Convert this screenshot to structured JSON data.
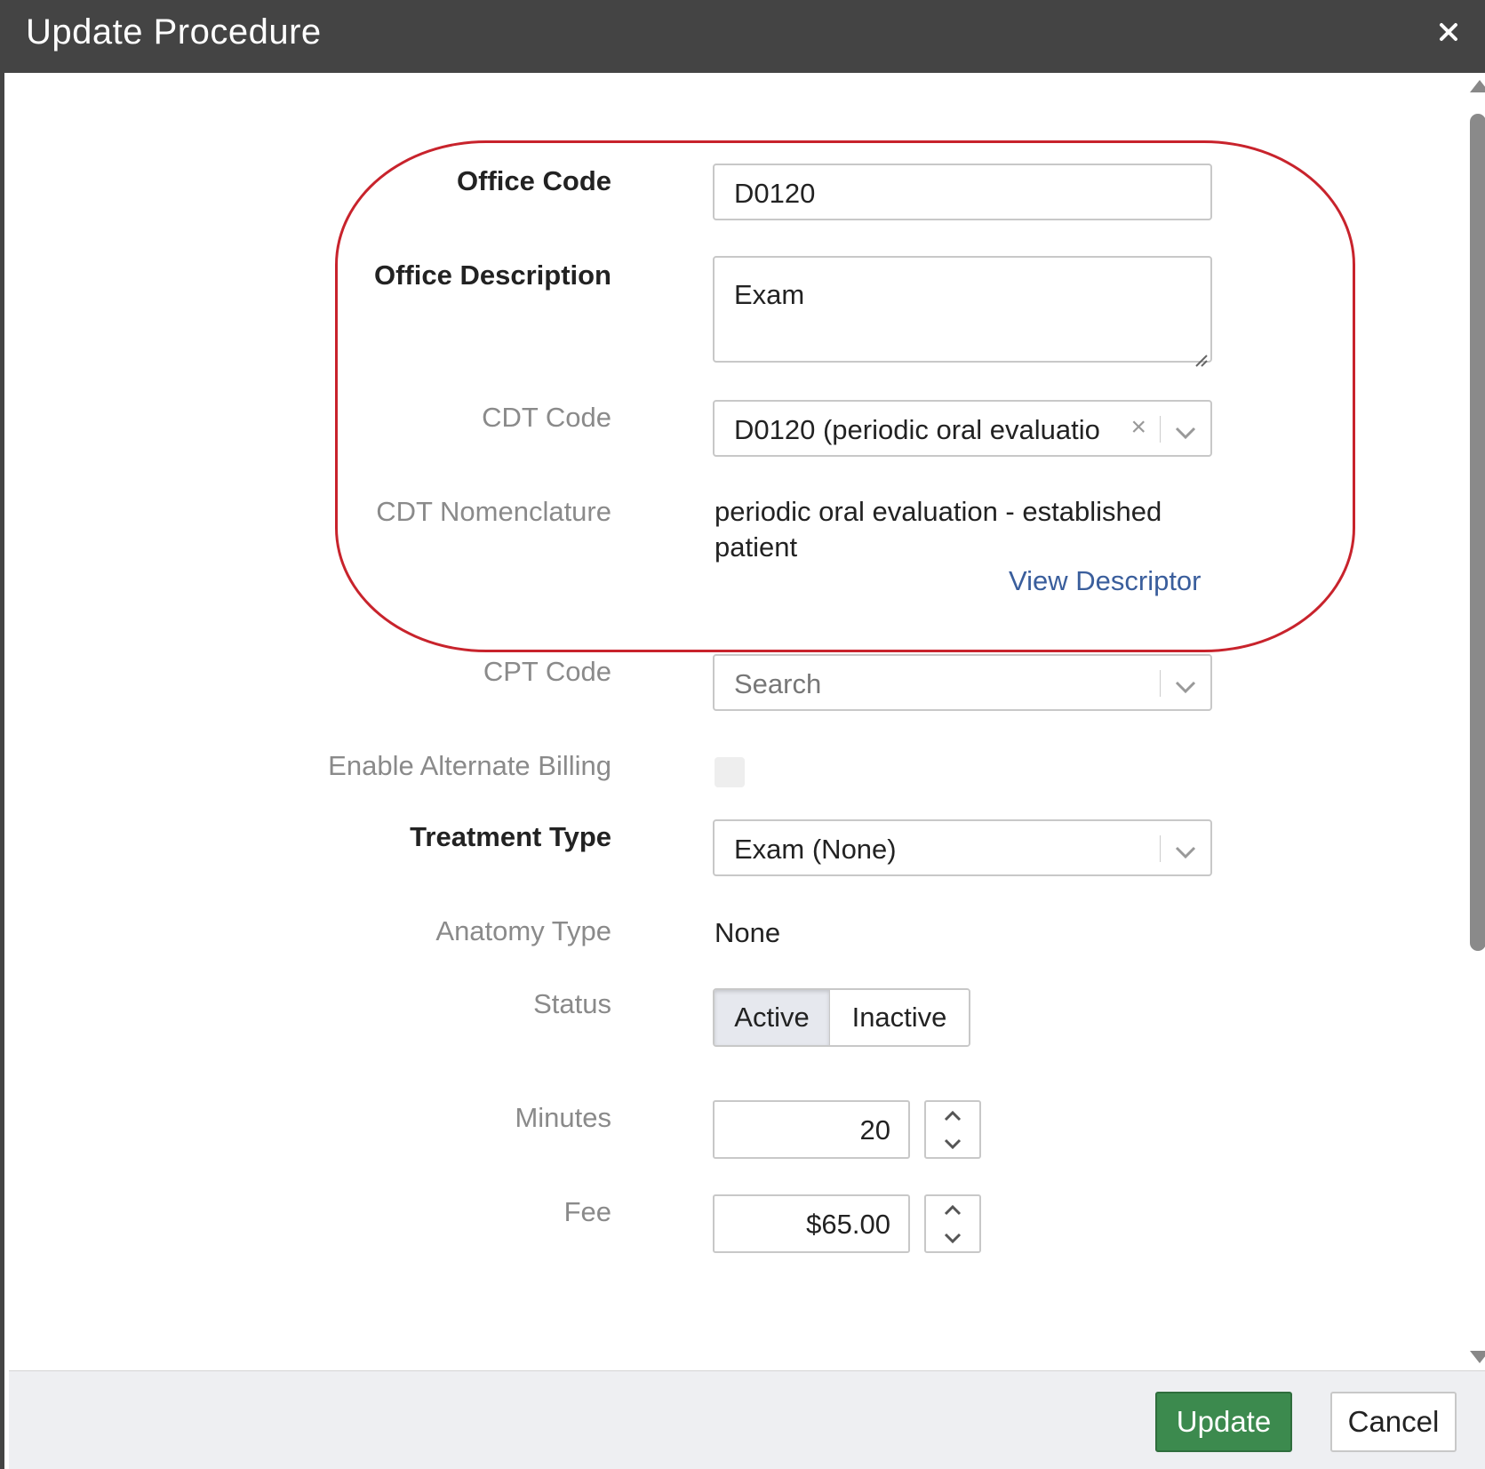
{
  "dialog": {
    "title": "Update Procedure",
    "close_icon": "close-icon"
  },
  "form": {
    "office_code": {
      "label": "Office Code",
      "value": "D0120"
    },
    "office_description": {
      "label": "Office Description",
      "value": "Exam"
    },
    "cdt_code": {
      "label": "CDT Code",
      "value": "D0120 (periodic oral evaluatio",
      "clear_glyph": "×"
    },
    "cdt_nomenclature": {
      "label": "CDT Nomenclature",
      "value_line1": "periodic oral evaluation - established",
      "value_line2": "patient",
      "link": "View Descriptor"
    },
    "cpt_code": {
      "label": "CPT Code",
      "placeholder": "Search"
    },
    "enable_alternate_billing": {
      "label": "Enable Alternate Billing",
      "checked": false
    },
    "treatment_type": {
      "label": "Treatment Type",
      "value": "Exam (None)"
    },
    "anatomy_type": {
      "label": "Anatomy Type",
      "value": "None"
    },
    "status": {
      "label": "Status",
      "options": [
        "Active",
        "Inactive"
      ],
      "selected": "Active"
    },
    "minutes": {
      "label": "Minutes",
      "value": "20"
    },
    "fee": {
      "label": "Fee",
      "value": "$65.00"
    }
  },
  "footer": {
    "update_label": "Update",
    "cancel_label": "Cancel"
  },
  "colors": {
    "titlebar": "#444444",
    "highlight": "#c8232c",
    "update_button": "#3c8a4e",
    "link": "#3a5e9c"
  }
}
